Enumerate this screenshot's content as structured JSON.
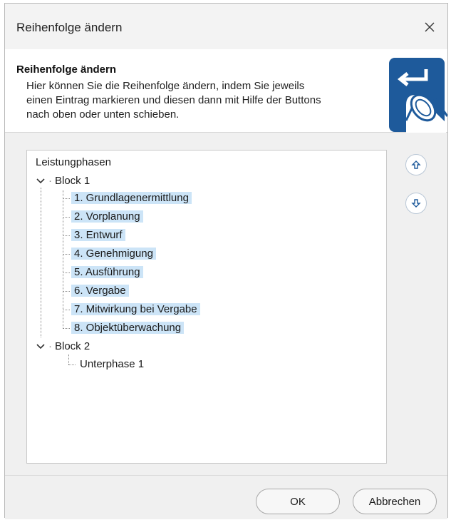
{
  "window": {
    "title": "Reihenfolge ändern"
  },
  "header": {
    "title": "Reihenfolge ändern",
    "description": "Hier können Sie die Reihenfolge ändern, indem Sie jeweils\neinen Eintrag markieren und diesen dann mit Hilfe der Buttons\nnach oben oder unten schieben.",
    "icon": "enter-key-touch-icon"
  },
  "tree": {
    "root": "Leistungphasen",
    "blocks": [
      {
        "label": "Block 1",
        "items": [
          "1. Grundlagenermittlung",
          "2. Vorplanung",
          "3. Entwurf",
          "4. Genehmigung",
          "5. Ausführung",
          "6. Vergabe",
          "7. Mitwirkung bei Vergabe",
          "8. Objektüberwachung"
        ]
      },
      {
        "label": "Block 2",
        "items": [
          "Unterphase 1"
        ]
      }
    ]
  },
  "side_buttons": {
    "up_icon": "arrow-up-icon",
    "down_icon": "arrow-down-icon"
  },
  "footer": {
    "ok_label": "OK",
    "cancel_label": "Abbrechen"
  },
  "colors": {
    "selection": "#cce4f7",
    "accent": "#1e5a9b"
  }
}
